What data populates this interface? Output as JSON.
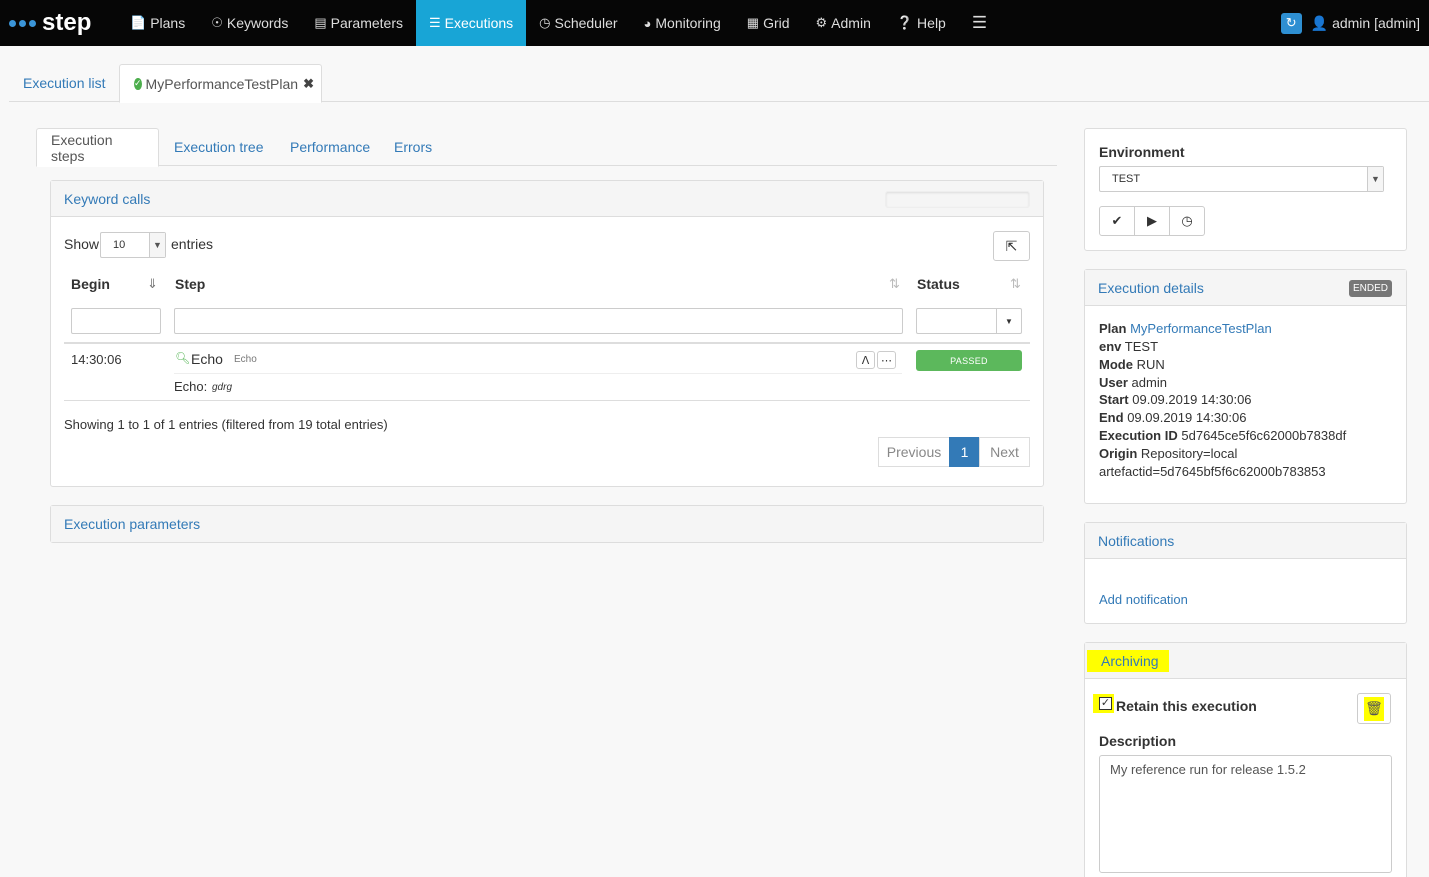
{
  "brand": {
    "name": "step"
  },
  "nav": {
    "items": [
      {
        "label": "Plans",
        "icon": "file-icon"
      },
      {
        "label": "Keywords",
        "icon": "target-icon"
      },
      {
        "label": "Parameters",
        "icon": "list-icon"
      },
      {
        "label": "Executions",
        "icon": "tasks-icon"
      },
      {
        "label": "Scheduler",
        "icon": "clock-icon"
      },
      {
        "label": "Monitoring",
        "icon": "dashboard-icon"
      },
      {
        "label": "Grid",
        "icon": "grid-icon"
      },
      {
        "label": "Admin",
        "icon": "gear-icon"
      },
      {
        "label": "Help",
        "icon": "help-icon"
      }
    ],
    "active": "Executions",
    "user": "admin [admin]",
    "accent": "#18a5d6"
  },
  "main_tabs": {
    "list": "Execution list",
    "current": "MyPerformanceTestPlan"
  },
  "sub_tabs": [
    "Execution steps",
    "Execution tree",
    "Performance",
    "Errors"
  ],
  "keyword_calls": {
    "title": "Keyword calls",
    "show_label": "Show",
    "page_size": "10",
    "entries_label": "entries",
    "columns": {
      "begin": "Begin",
      "step": "Step",
      "status": "Status"
    },
    "rows": [
      {
        "begin": "14:30:06",
        "step": "Echo",
        "step_type": "Echo",
        "output_label": "Echo:",
        "output_value": "gdrg",
        "status": "PASSED"
      }
    ],
    "summary": "Showing 1 to 1 of 1 entries (filtered from 19 total entries)",
    "pager": {
      "prev": "Previous",
      "page": "1",
      "next": "Next"
    }
  },
  "execution_parameters": {
    "title": "Execution parameters"
  },
  "environment": {
    "label": "Environment",
    "value": "TEST"
  },
  "execution_details": {
    "title": "Execution details",
    "status": "ENDED",
    "plan_label": "Plan",
    "plan": "MyPerformanceTestPlan",
    "env_label": "env",
    "env": "TEST",
    "mode_label": "Mode",
    "mode": "RUN",
    "user_label": "User",
    "user": "admin",
    "start_label": "Start",
    "start": "09.09.2019 14:30:06",
    "end_label": "End",
    "end": "09.09.2019 14:30:06",
    "id_label": "Execution ID",
    "id": "5d7645ce5f6c62000b7838df",
    "origin_label": "Origin",
    "origin_1": "Repository=local",
    "origin_2": "artefactid=5d7645bf5f6c62000b783853"
  },
  "notifications": {
    "title": "Notifications",
    "add": "Add notification"
  },
  "archiving": {
    "title": "Archiving",
    "retain_label": "Retain this execution",
    "retain_checked": true,
    "description_label": "Description",
    "description": "My reference run for release 1.5.2"
  }
}
